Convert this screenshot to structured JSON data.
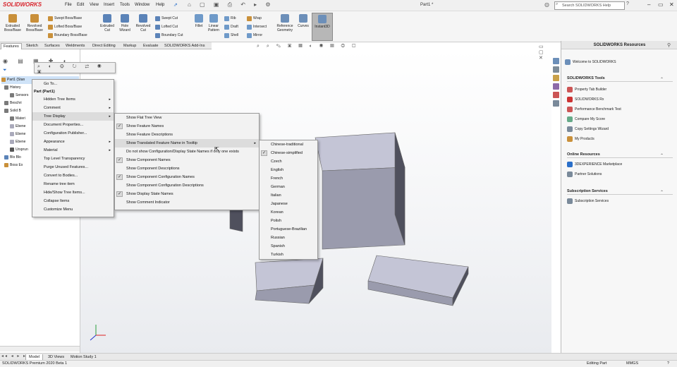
{
  "app": {
    "logo_text": "SOLIDWORKS",
    "doc_title": "Part1 *"
  },
  "menubar": [
    "File",
    "Edit",
    "View",
    "Insert",
    "Tools",
    "Window",
    "Help"
  ],
  "search": {
    "placeholder": "Search SOLIDWORKS Help"
  },
  "ribbon": {
    "big": [
      {
        "label1": "Extruded",
        "label2": "Boss/Base"
      },
      {
        "label1": "Revolved",
        "label2": "Boss/Base"
      },
      {
        "label1": "Extruded",
        "label2": "Cut"
      },
      {
        "label1": "Hole",
        "label2": "Wizard"
      },
      {
        "label1": "Revolved",
        "label2": "Cut"
      },
      {
        "label1": "Fillet",
        "label2": ""
      },
      {
        "label1": "Linear",
        "label2": "Pattern"
      },
      {
        "label1": "Reference",
        "label2": "Geometry"
      },
      {
        "label1": "Curves",
        "label2": ""
      },
      {
        "label1": "Instant3D",
        "label2": ""
      }
    ],
    "small1": [
      "Swept Boss/Base",
      "Lofted Boss/Base",
      "Boundary Boss/Base"
    ],
    "small2": [
      "Swept Cut",
      "Lofted Cut",
      "Boundary Cut"
    ],
    "small3": [
      "Rib",
      "Draft",
      "Shell"
    ],
    "small4": [
      "Wrap",
      "Intersect",
      "Mirror"
    ]
  },
  "tabs": [
    "Features",
    "Sketch",
    "Surfaces",
    "Weldments",
    "Direct Editing",
    "Markup",
    "Evaluate",
    "SOLIDWORKS Add-Ins"
  ],
  "tree": [
    "Part1 (Stan",
    "History",
    "Sensors",
    "Beschri",
    "Solid B",
    "Materi",
    "Ebene",
    "Ebene",
    "Ebene",
    "Ursprun",
    "Blo Blo",
    "Boss Ex"
  ],
  "context_menu": {
    "title": "Part (Part1)",
    "goto": "Go To...",
    "items": [
      {
        "label": "Hidden Tree Items",
        "arrow": true
      },
      {
        "label": "Comment",
        "arrow": true
      },
      {
        "label": "Tree Display",
        "arrow": true
      },
      {
        "label": "Document Properties...",
        "arrow": false
      },
      {
        "label": "Configuration Publisher...",
        "arrow": false
      },
      {
        "label": "Appearance",
        "arrow": true
      },
      {
        "label": "Material",
        "arrow": true
      },
      {
        "label": "Top Level Transparency",
        "arrow": false
      },
      {
        "label": "Purge Unused Features...",
        "arrow": false
      },
      {
        "label": "Convert to Bodies...",
        "arrow": false
      },
      {
        "label": "Rename tree item",
        "arrow": false
      },
      {
        "label": "Hide/Show Tree Items...",
        "arrow": false
      },
      {
        "label": "Collapse Items",
        "arrow": false
      },
      {
        "label": "Customize Menu",
        "arrow": false
      }
    ]
  },
  "tree_display_menu": [
    {
      "label": "Show Flat Tree View",
      "checked": false
    },
    {
      "label": "Show Feature Names",
      "checked": true
    },
    {
      "label": "Show Feature Descriptions",
      "checked": false
    },
    {
      "label": "Show Translated Feature Name in Tooltip",
      "checked": false,
      "arrow": true
    },
    {
      "label": "Do not show Configuration/Display State Names if only one exists",
      "checked": false
    },
    {
      "label": "Show Component Names",
      "checked": true
    },
    {
      "label": "Show Component Descriptions",
      "checked": false
    },
    {
      "label": "Show Component Configuration Names",
      "checked": true
    },
    {
      "label": "Show Component Configuration Descriptions",
      "checked": false
    },
    {
      "label": "Show Display State Names",
      "checked": true
    },
    {
      "label": "Show Comment Indicator",
      "checked": false
    }
  ],
  "language_menu": [
    {
      "label": "Chinese-traditional",
      "checked": false
    },
    {
      "label": "Chinese-simplified",
      "checked": true
    },
    {
      "label": "Czech",
      "checked": false
    },
    {
      "label": "English",
      "checked": false
    },
    {
      "label": "French",
      "checked": false
    },
    {
      "label": "German",
      "checked": false
    },
    {
      "label": "Italian",
      "checked": false
    },
    {
      "label": "Japanese",
      "checked": false
    },
    {
      "label": "Korean",
      "checked": false
    },
    {
      "label": "Polish",
      "checked": false
    },
    {
      "label": "Portuguese-Brazilian",
      "checked": false
    },
    {
      "label": "Russian",
      "checked": false
    },
    {
      "label": "Spanish",
      "checked": false
    },
    {
      "label": "Turkish",
      "checked": false
    }
  ],
  "taskpane": {
    "title": "SOLIDWORKS Resources",
    "welcome": "Welcome to SOLIDWORKS",
    "tools_header": "SOLIDWORKS Tools",
    "tools": [
      "Property Tab Builder",
      "SOLIDWORKS Rx",
      "Performance Benchmark Test",
      "Compare My Score",
      "Copy Settings Wizard",
      "My Products"
    ],
    "online_header": "Online Resources",
    "online": [
      "3DEXPERIENCE Marketplace",
      "Partner Solutions"
    ],
    "sub_header": "Subscription Services",
    "sub": [
      "Subscription Services"
    ]
  },
  "bottom_tabs": [
    "Model",
    "3D Views",
    "Motion Study 1"
  ],
  "status": {
    "app": "SOLIDWORKS Premium 2020 Beta 1",
    "mode": "Editing Part",
    "units": "MMGS"
  },
  "colors": {
    "accent": "#d8262e",
    "box_face": "#9a9bad",
    "box_top": "#c4c5d6",
    "box_side": "#4f505d"
  }
}
